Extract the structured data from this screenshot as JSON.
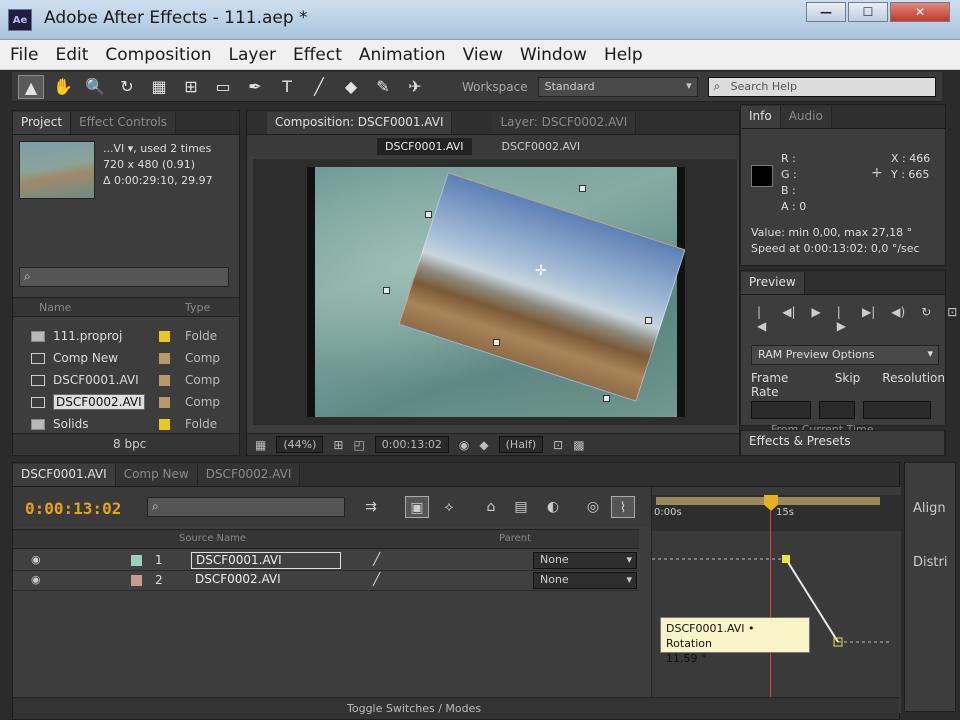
{
  "window": {
    "logo": "Ae",
    "title": "Adobe After Effects - 111.aep *",
    "min": "—",
    "max": "☐",
    "close": "✕"
  },
  "menu": [
    "File",
    "Edit",
    "Composition",
    "Layer",
    "Effect",
    "Animation",
    "View",
    "Window",
    "Help"
  ],
  "toolbar": {
    "tools": [
      "▲",
      "✋",
      "🔍",
      "↻",
      "▦",
      "⊞",
      "▭",
      "✒",
      "T",
      "╱",
      "◆",
      "✎",
      "✈"
    ],
    "workspace_label": "Workspace",
    "workspace_value": "Standard",
    "search_placeholder": "Search Help"
  },
  "project": {
    "tabs": [
      "Project",
      "Effect Controls"
    ],
    "info_line1": "...VI ▾, used 2 times",
    "info_line2": "720 x 480 (0.91)",
    "info_line3": "Δ 0:00:29:10, 29.97",
    "columns": {
      "name": "Name",
      "type": "Type"
    },
    "rows": [
      {
        "name": "111.proproj",
        "type": "Folde",
        "swatch": "#e8c81e",
        "folder": true
      },
      {
        "name": "Comp New",
        "type": "Comp",
        "swatch": "#b79a6a",
        "folder": false
      },
      {
        "name": "DSCF0001.AVI",
        "type": "Comp",
        "swatch": "#b79a6a",
        "folder": false
      },
      {
        "name": "DSCF0002.AVI",
        "type": "Comp",
        "swatch": "#b79a6a",
        "folder": false
      },
      {
        "name": "Solids",
        "type": "Folde",
        "swatch": "#e8c81e",
        "folder": true
      }
    ],
    "bpc": "8 bpc"
  },
  "composition": {
    "tab": "Composition: DSCF0001.AVI",
    "layer_tab": "Layer: DSCF0002.AVI",
    "subtabs": [
      "DSCF0001.AVI",
      "DSCF0002.AVI"
    ],
    "zoom": "(44%)",
    "timecode": "0:00:13:02",
    "resolution": "(Half)"
  },
  "info": {
    "tabs": [
      "Info",
      "Audio"
    ],
    "r": "R :",
    "g": "G :",
    "b": "B :",
    "a": "A : 0",
    "x": "X : 466",
    "y": "Y : 665",
    "value_line": "Value: min 0,00, max 27,18 °",
    "speed_line": "Speed at 0:00:13:02: 0,0 °/sec"
  },
  "preview": {
    "tab": "Preview",
    "buttons": [
      "|◀",
      "◀|",
      "▶",
      "|▶",
      "▶|",
      "◀)",
      "↻",
      "⊡"
    ],
    "options": "RAM Preview Options",
    "labels": [
      "Frame Rate",
      "Skip",
      "Resolution"
    ],
    "from_current": "From Current Time",
    "effects_tab": "Effects & Presets"
  },
  "timeline": {
    "tabs": [
      "DSCF0001.AVI",
      "Comp New",
      "DSCF0002.AVI"
    ],
    "timecode": "0:00:13:02",
    "colhead_source": "Source Name",
    "colhead_parent": "Parent",
    "layers": [
      {
        "num": "1",
        "name": "DSCF0001.AVI",
        "parent": "None",
        "swatch": "#9ad0c0",
        "selected": true
      },
      {
        "num": "2",
        "name": "DSCF0002.AVI",
        "parent": "None",
        "swatch": "#c89a8a",
        "selected": false
      }
    ],
    "ruler_start": "0:00s",
    "ruler_mark": "15s",
    "tooltip_line1": "DSCF0001.AVI • Rotation",
    "tooltip_line2": "11,59 °",
    "toggle_label": "Toggle Switches / Modes"
  },
  "align": {
    "title": "Align",
    "distribute": "Distri"
  }
}
